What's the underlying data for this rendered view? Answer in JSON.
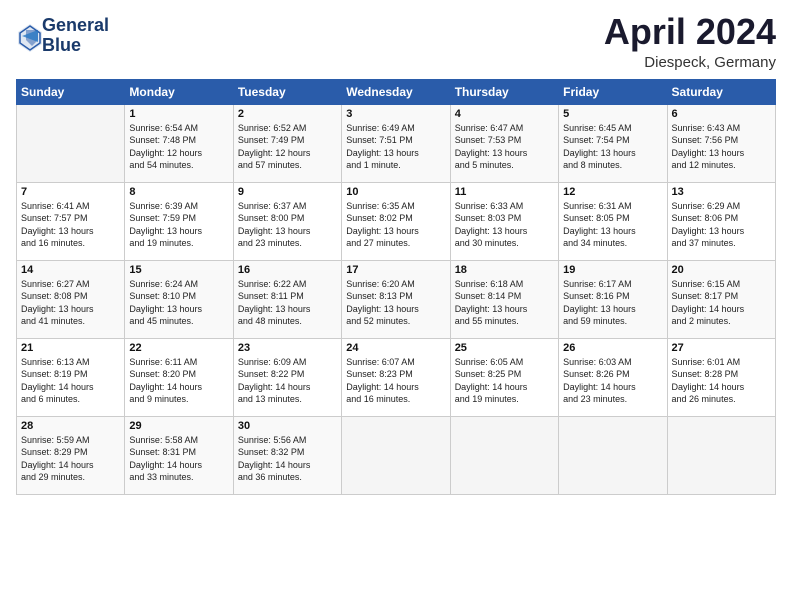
{
  "header": {
    "logo_line1": "General",
    "logo_line2": "Blue",
    "title": "April 2024",
    "location": "Diespeck, Germany"
  },
  "calendar": {
    "days_of_week": [
      "Sunday",
      "Monday",
      "Tuesday",
      "Wednesday",
      "Thursday",
      "Friday",
      "Saturday"
    ],
    "weeks": [
      [
        {
          "day": "",
          "info": ""
        },
        {
          "day": "1",
          "info": "Sunrise: 6:54 AM\nSunset: 7:48 PM\nDaylight: 12 hours\nand 54 minutes."
        },
        {
          "day": "2",
          "info": "Sunrise: 6:52 AM\nSunset: 7:49 PM\nDaylight: 12 hours\nand 57 minutes."
        },
        {
          "day": "3",
          "info": "Sunrise: 6:49 AM\nSunset: 7:51 PM\nDaylight: 13 hours\nand 1 minute."
        },
        {
          "day": "4",
          "info": "Sunrise: 6:47 AM\nSunset: 7:53 PM\nDaylight: 13 hours\nand 5 minutes."
        },
        {
          "day": "5",
          "info": "Sunrise: 6:45 AM\nSunset: 7:54 PM\nDaylight: 13 hours\nand 8 minutes."
        },
        {
          "day": "6",
          "info": "Sunrise: 6:43 AM\nSunset: 7:56 PM\nDaylight: 13 hours\nand 12 minutes."
        }
      ],
      [
        {
          "day": "7",
          "info": "Sunrise: 6:41 AM\nSunset: 7:57 PM\nDaylight: 13 hours\nand 16 minutes."
        },
        {
          "day": "8",
          "info": "Sunrise: 6:39 AM\nSunset: 7:59 PM\nDaylight: 13 hours\nand 19 minutes."
        },
        {
          "day": "9",
          "info": "Sunrise: 6:37 AM\nSunset: 8:00 PM\nDaylight: 13 hours\nand 23 minutes."
        },
        {
          "day": "10",
          "info": "Sunrise: 6:35 AM\nSunset: 8:02 PM\nDaylight: 13 hours\nand 27 minutes."
        },
        {
          "day": "11",
          "info": "Sunrise: 6:33 AM\nSunset: 8:03 PM\nDaylight: 13 hours\nand 30 minutes."
        },
        {
          "day": "12",
          "info": "Sunrise: 6:31 AM\nSunset: 8:05 PM\nDaylight: 13 hours\nand 34 minutes."
        },
        {
          "day": "13",
          "info": "Sunrise: 6:29 AM\nSunset: 8:06 PM\nDaylight: 13 hours\nand 37 minutes."
        }
      ],
      [
        {
          "day": "14",
          "info": "Sunrise: 6:27 AM\nSunset: 8:08 PM\nDaylight: 13 hours\nand 41 minutes."
        },
        {
          "day": "15",
          "info": "Sunrise: 6:24 AM\nSunset: 8:10 PM\nDaylight: 13 hours\nand 45 minutes."
        },
        {
          "day": "16",
          "info": "Sunrise: 6:22 AM\nSunset: 8:11 PM\nDaylight: 13 hours\nand 48 minutes."
        },
        {
          "day": "17",
          "info": "Sunrise: 6:20 AM\nSunset: 8:13 PM\nDaylight: 13 hours\nand 52 minutes."
        },
        {
          "day": "18",
          "info": "Sunrise: 6:18 AM\nSunset: 8:14 PM\nDaylight: 13 hours\nand 55 minutes."
        },
        {
          "day": "19",
          "info": "Sunrise: 6:17 AM\nSunset: 8:16 PM\nDaylight: 13 hours\nand 59 minutes."
        },
        {
          "day": "20",
          "info": "Sunrise: 6:15 AM\nSunset: 8:17 PM\nDaylight: 14 hours\nand 2 minutes."
        }
      ],
      [
        {
          "day": "21",
          "info": "Sunrise: 6:13 AM\nSunset: 8:19 PM\nDaylight: 14 hours\nand 6 minutes."
        },
        {
          "day": "22",
          "info": "Sunrise: 6:11 AM\nSunset: 8:20 PM\nDaylight: 14 hours\nand 9 minutes."
        },
        {
          "day": "23",
          "info": "Sunrise: 6:09 AM\nSunset: 8:22 PM\nDaylight: 14 hours\nand 13 minutes."
        },
        {
          "day": "24",
          "info": "Sunrise: 6:07 AM\nSunset: 8:23 PM\nDaylight: 14 hours\nand 16 minutes."
        },
        {
          "day": "25",
          "info": "Sunrise: 6:05 AM\nSunset: 8:25 PM\nDaylight: 14 hours\nand 19 minutes."
        },
        {
          "day": "26",
          "info": "Sunrise: 6:03 AM\nSunset: 8:26 PM\nDaylight: 14 hours\nand 23 minutes."
        },
        {
          "day": "27",
          "info": "Sunrise: 6:01 AM\nSunset: 8:28 PM\nDaylight: 14 hours\nand 26 minutes."
        }
      ],
      [
        {
          "day": "28",
          "info": "Sunrise: 5:59 AM\nSunset: 8:29 PM\nDaylight: 14 hours\nand 29 minutes."
        },
        {
          "day": "29",
          "info": "Sunrise: 5:58 AM\nSunset: 8:31 PM\nDaylight: 14 hours\nand 33 minutes."
        },
        {
          "day": "30",
          "info": "Sunrise: 5:56 AM\nSunset: 8:32 PM\nDaylight: 14 hours\nand 36 minutes."
        },
        {
          "day": "",
          "info": ""
        },
        {
          "day": "",
          "info": ""
        },
        {
          "day": "",
          "info": ""
        },
        {
          "day": "",
          "info": ""
        }
      ]
    ]
  }
}
